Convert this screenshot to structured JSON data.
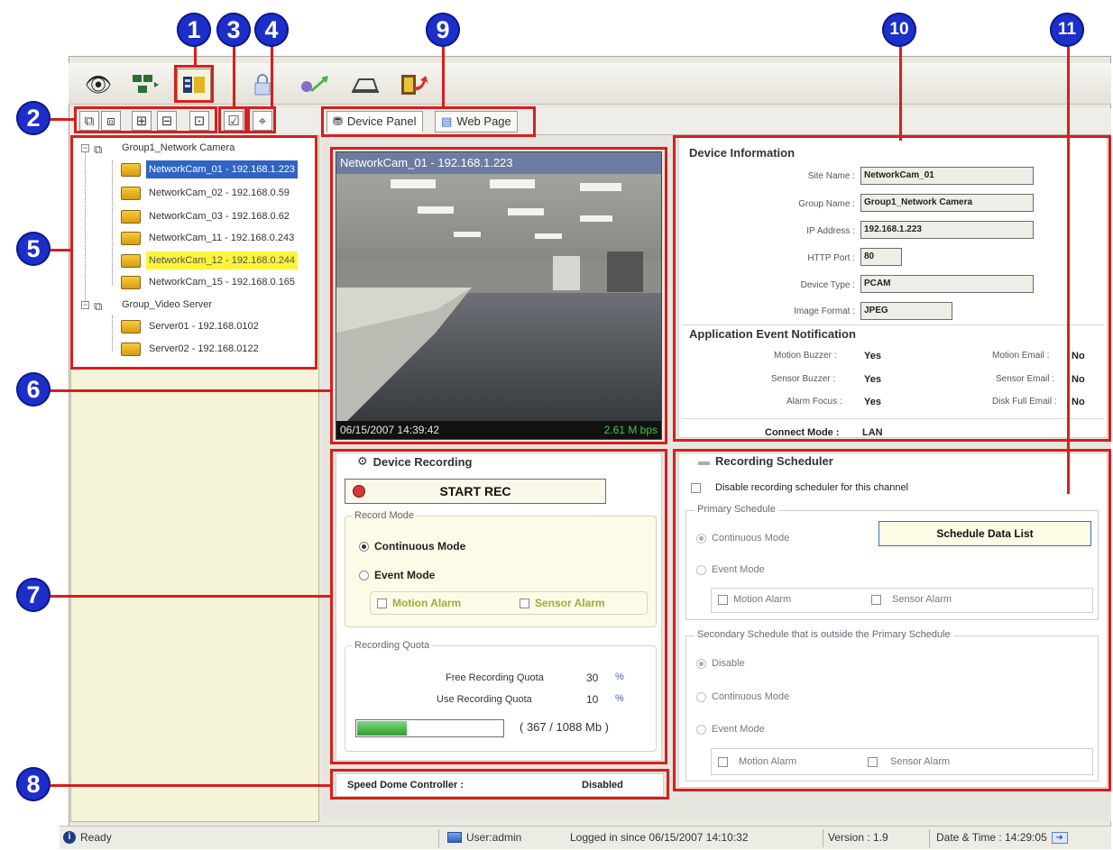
{
  "callouts": [
    "1",
    "2",
    "3",
    "4",
    "5",
    "6",
    "7",
    "8",
    "9",
    "10",
    "11"
  ],
  "icons": {
    "live_view": "eye-icon",
    "device_manager": "network-devices-icon",
    "configuration": "config-panel-icon",
    "lock": "lock-icon",
    "playback": "playback-arrow-icon",
    "export": "export-icon",
    "exit": "exit-icon",
    "add_group": "add-group-icon",
    "remove_group": "remove-group-icon",
    "add_device": "add-device-icon",
    "remove_device": "remove-device-icon",
    "edit_device": "edit-device-icon",
    "apply": "apply-check-icon",
    "search": "search-device-icon"
  },
  "tabs": [
    {
      "label": "Device Panel",
      "active": true
    },
    {
      "label": "Web Page",
      "active": false
    }
  ],
  "tree": {
    "groups": [
      {
        "name": "Group1_Network Camera",
        "items": [
          {
            "label": "NetworkCam_01 - 192.168.1.223",
            "state": "selected"
          },
          {
            "label": "NetworkCam_02 - 192.168.0.59",
            "state": "normal"
          },
          {
            "label": "NetworkCam_03 - 192.168.0.62",
            "state": "normal"
          },
          {
            "label": "NetworkCam_11 - 192.168.0.243",
            "state": "normal"
          },
          {
            "label": "NetworkCam_12 - 192.168.0.244",
            "state": "highlight"
          },
          {
            "label": "NetworkCam_15 - 192.168.0.165",
            "state": "normal"
          }
        ]
      },
      {
        "name": "Group_Video Server",
        "items": [
          {
            "label": "Server01 - 192.168.0102",
            "state": "normal"
          },
          {
            "label": "Server02 - 192.168.0122",
            "state": "normal"
          }
        ]
      }
    ]
  },
  "video": {
    "title": "NetworkCam_01 - 192.168.1.223",
    "timestamp": "06/15/2007 14:39:42",
    "bitrate": "2.61 M bps"
  },
  "device_recording": {
    "title": "Device Recording",
    "start_label": "START REC",
    "record_mode": {
      "label": "Record Mode",
      "continuous": "Continuous Mode",
      "event": "Event Mode",
      "selected": "continuous",
      "motion": "Motion Alarm",
      "sensor": "Sensor Alarm"
    },
    "quota": {
      "label": "Recording Quota",
      "free_label": "Free Recording Quota",
      "free_value": "30",
      "use_label": "Use Recording Quota",
      "use_value": "10",
      "unit": "%",
      "usage_text": "( 367 / 1088 Mb )",
      "usage_fraction": 0.34
    }
  },
  "speed_dome": {
    "label": "Speed Dome Controller :",
    "value": "Disabled"
  },
  "device_info": {
    "title": "Device Information",
    "fields": [
      {
        "label": "Site Name :",
        "value": "NetworkCam_01"
      },
      {
        "label": "Group Name :",
        "value": "Group1_Network Camera"
      },
      {
        "label": "IP Address :",
        "value": "192.168.1.223"
      },
      {
        "label": "HTTP Port :",
        "value": "80"
      },
      {
        "label": "Device Type :",
        "value": "PCAM"
      },
      {
        "label": "Image Format :",
        "value": "JPEG"
      }
    ],
    "notification_title": "Application Event Notification",
    "notifications": [
      {
        "label": "Motion Buzzer :",
        "value": "Yes",
        "label2": "Motion Email :",
        "value2": "No"
      },
      {
        "label": "Sensor Buzzer :",
        "value": "Yes",
        "label2": "Sensor Email :",
        "value2": "No"
      },
      {
        "label": "Alarm Focus :",
        "value": "Yes",
        "label2": "Disk Full Email :",
        "value2": "No"
      }
    ],
    "connect_label": "Connect Mode :",
    "connect_value": "LAN"
  },
  "scheduler": {
    "title": "Recording Scheduler",
    "disable_label": "Disable recording scheduler for this channel",
    "primary_label": "Primary Schedule",
    "primary_continuous": "Continuous Mode",
    "primary_event": "Event Mode",
    "primary_motion": "Motion Alarm",
    "primary_sensor": "Sensor Alarm",
    "data_list_button": "Schedule Data List",
    "secondary_label": "Secondary Schedule that is outside the Primary Schedule",
    "secondary_disable": "Disable",
    "secondary_continuous": "Continuous Mode",
    "secondary_event": "Event Mode",
    "secondary_motion": "Motion Alarm",
    "secondary_sensor": "Sensor Alarm"
  },
  "status": {
    "ready": "Ready",
    "user": "User:admin",
    "logged": "Logged in since 06/15/2007 14:10:32",
    "version": "Version :  1.9",
    "datetime": "Date & Time :  14:29:05"
  },
  "colors": {
    "callout": "#1d2fc9",
    "annotation": "#d81e1e",
    "selection": "#2f63c4",
    "highlight": "#fbf43a",
    "bitrate": "#3ecb3e"
  }
}
